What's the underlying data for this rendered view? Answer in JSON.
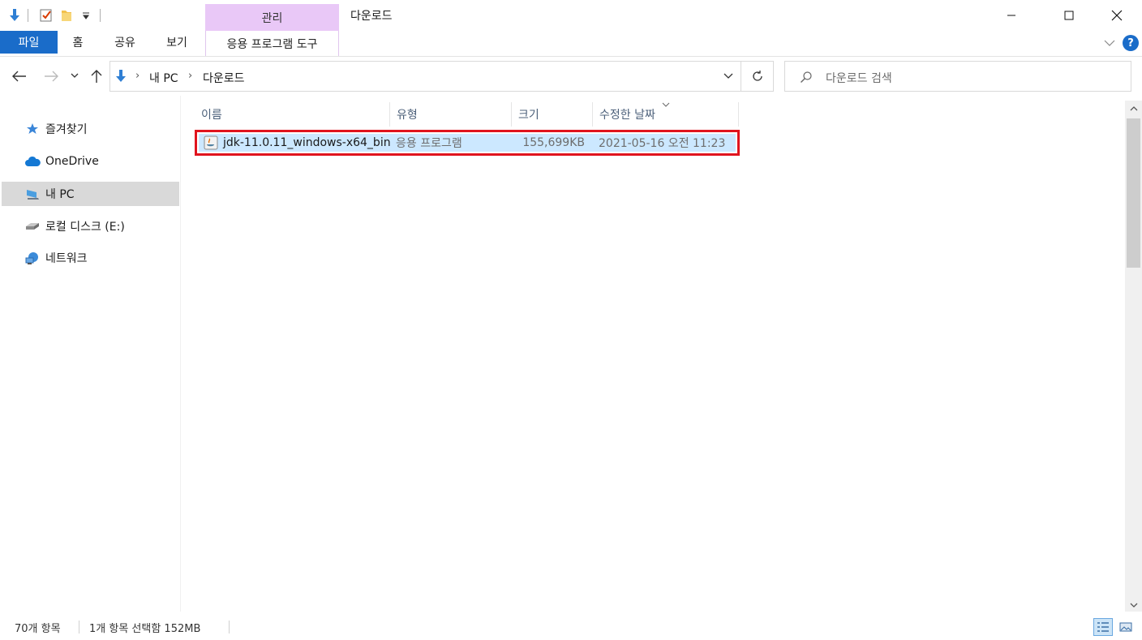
{
  "window": {
    "title": "다운로드",
    "context_tab_group": "관리",
    "minimize_label": "—",
    "maximize_label": "☐",
    "close_label": "✕"
  },
  "ribbon": {
    "tabs": [
      {
        "label": "파일"
      },
      {
        "label": "홈"
      },
      {
        "label": "공유"
      },
      {
        "label": "보기"
      },
      {
        "label": "응용 프로그램 도구"
      }
    ],
    "help_label": "?"
  },
  "address": {
    "breadcrumbs": [
      "내 PC",
      "다운로드"
    ],
    "search_placeholder": "다운로드 검색"
  },
  "nav_pane": {
    "items": [
      {
        "label": "즐겨찾기",
        "icon": "star-icon"
      },
      {
        "label": "OneDrive",
        "icon": "cloud-icon"
      },
      {
        "label": "내 PC",
        "icon": "computer-icon",
        "selected": true
      },
      {
        "label": "로컬 디스크 (E:)",
        "icon": "drive-icon"
      },
      {
        "label": "네트워크",
        "icon": "network-icon"
      }
    ]
  },
  "columns": {
    "name": "이름",
    "type": "유형",
    "size": "크기",
    "modified": "수정한 날짜"
  },
  "files": [
    {
      "name": "jdk-11.0.11_windows-x64_bin",
      "type": "응용 프로그램",
      "size": "155,699KB",
      "modified": "2021-05-16 오전 11:23"
    }
  ],
  "status": {
    "item_count": "70개 항목",
    "selection": "1개 항목 선택함 152MB"
  },
  "colors": {
    "accent": "#1a6cc9",
    "context_tab": "#e9c8f7",
    "selection": "#cce8ff",
    "highlight_border": "#e0141e"
  }
}
